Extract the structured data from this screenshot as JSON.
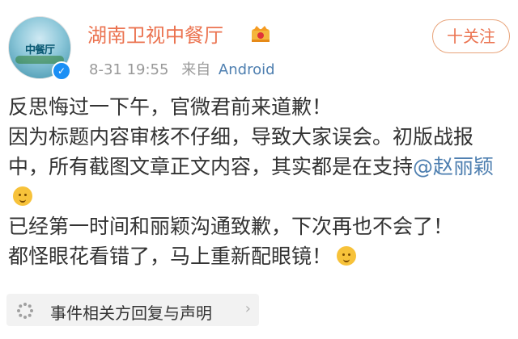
{
  "post": {
    "author": {
      "name": "湖南卫视中餐厅",
      "avatar_text": "中餐厅",
      "verified": true
    },
    "meta": {
      "date": "8-31 19:55",
      "source_prefix": "来自",
      "source": "Android"
    },
    "follow_label": "十关注",
    "content": {
      "line1": "反思悔过一下午，官微君前来道歉！",
      "line2_before": "因为标题内容审核不仔细，导致大家误会。初版战报中，所有截图文章正文内容，其实都是在支持",
      "mention": "@赵丽颖",
      "line3": "已经第一时间和丽颖沟通致歉，下次再也不会了！",
      "line4": "都怪眼花看错了，马上重新配眼镜！"
    },
    "topic_tag": {
      "label": "事件相关方回复与声明",
      "icon": "loading-icon"
    }
  },
  "colors": {
    "name": "#eb7350",
    "link": "#4e7fb0",
    "meta": "#999999",
    "text": "#333333",
    "follow_border": "#e8a47b",
    "tag_bg": "#f2f2f2"
  }
}
